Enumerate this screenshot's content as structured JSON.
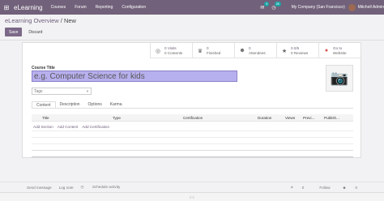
{
  "nav": {
    "app": "eLearning",
    "menu": [
      "Courses",
      "Forum",
      "Reporting",
      "Configuration"
    ],
    "company": "My Company (San Francisco)",
    "user": "Mitchell Admin",
    "chat_badge": "5",
    "activity_badge": "28"
  },
  "breadcrumb": {
    "parent": "eLearning Overview",
    "sep": " / ",
    "current": "New"
  },
  "buttons": {
    "save": "Save",
    "discard": "Discard"
  },
  "stats": [
    {
      "icon": "globe-icon",
      "glyph": "◎",
      "value": "0 Visits",
      "sub": "0 Contents"
    },
    {
      "icon": "trophy-icon",
      "glyph": "♛",
      "value": "0",
      "sub": "Finished"
    },
    {
      "icon": "users-icon",
      "glyph": "☻",
      "value": "0",
      "sub": "Attendees"
    },
    {
      "icon": "star-icon",
      "glyph": "★",
      "value": "0.0/5",
      "sub": "0 Reviews"
    },
    {
      "icon": "globe-red-icon",
      "glyph": "●",
      "value": "Go to",
      "sub": "Website"
    }
  ],
  "form": {
    "title_label": "Course Title",
    "title_placeholder": "e.g. Computer Science for kids",
    "tags_placeholder": "Tags"
  },
  "tabs": [
    "Content",
    "Description",
    "Options",
    "Karma"
  ],
  "table": {
    "columns": [
      "Title",
      "Type",
      "Certification",
      "Duration",
      "Views",
      "Previ...",
      "Publish..."
    ],
    "links": [
      "Add Section",
      "Add Content",
      "Add Certification"
    ]
  },
  "chatter": {
    "send": "Send message",
    "log": "Log note",
    "schedule": "Schedule activity",
    "count": "0",
    "follow": "Follow",
    "followers": "0"
  },
  "footer": "≡ ≡"
}
